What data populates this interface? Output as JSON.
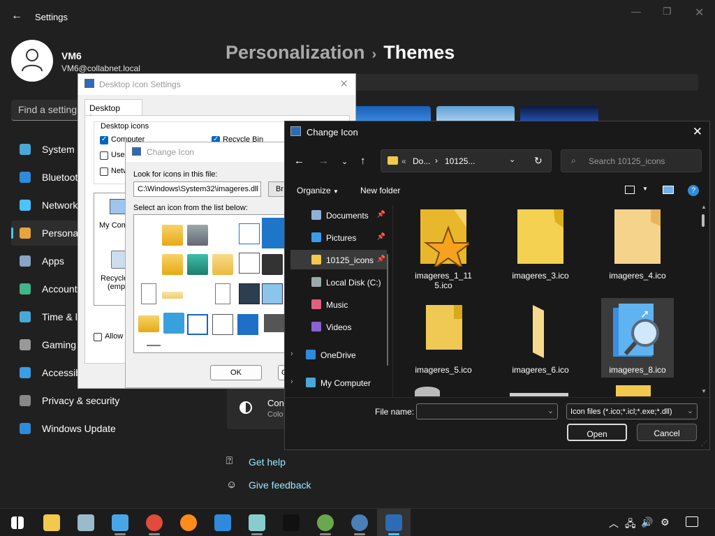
{
  "settings": {
    "title": "Settings",
    "user": {
      "name": "VM6",
      "email": "VM6@collabnet.local"
    },
    "search_placeholder": "Find a setting",
    "nav": [
      {
        "label": "System",
        "icon": "monitor-icon",
        "color": "#4aa8d8"
      },
      {
        "label": "Bluetooth & devices",
        "icon": "bluetooth-icon",
        "color": "#2e8bdb"
      },
      {
        "label": "Network & internet",
        "icon": "wifi-icon",
        "color": "#4cc2ff"
      },
      {
        "label": "Personalization",
        "icon": "brush-icon",
        "color": "#e8a33d"
      },
      {
        "label": "Apps",
        "icon": "apps-icon",
        "color": "#8aa4c8"
      },
      {
        "label": "Accounts",
        "icon": "person-icon",
        "color": "#3fb68b"
      },
      {
        "label": "Time & language",
        "icon": "clock-icon",
        "color": "#4aa8d8"
      },
      {
        "label": "Gaming",
        "icon": "gamepad-icon",
        "color": "#999"
      },
      {
        "label": "Accessibility",
        "icon": "accessibility-icon",
        "color": "#3b9de6"
      },
      {
        "label": "Privacy & security",
        "icon": "shield-icon",
        "color": "#888"
      },
      {
        "label": "Windows Update",
        "icon": "update-icon",
        "color": "#2e8bdb"
      }
    ],
    "breadcrumb": {
      "parent": "Personalization",
      "current": "Themes"
    },
    "contrast_label": "Con",
    "contrast_sub": "Colo",
    "get_help": "Get help",
    "give_feedback": "Give feedback"
  },
  "desktop_icon_settings": {
    "title": "Desktop Icon Settings",
    "tab": "Desktop Icons",
    "group_label": "Desktop icons",
    "checks": [
      {
        "label": "Computer",
        "checked": true
      },
      {
        "label": "Recycle Bin",
        "checked": true
      },
      {
        "label": "User",
        "checked": false
      },
      {
        "label": "Netw",
        "checked": false
      }
    ],
    "preview_labels": [
      "My Comp",
      "Recycle",
      "(empt"
    ],
    "allow_label": "Allow t"
  },
  "change_icon_classic": {
    "title": "Change Icon",
    "look_for_label": "Look for icons in this file:",
    "path_value": "C:\\Windows\\System32\\imageres.dll",
    "browse_label": "Br",
    "select_label": "Select an icon from the list below:",
    "ok_label": "OK",
    "cancel_partial": "C"
  },
  "file_dialog": {
    "title": "Change Icon",
    "address": {
      "prefix": "«",
      "part1": "Do...",
      "part2": "10125..."
    },
    "search_placeholder": "Search 10125_icons",
    "organize": "Organize",
    "new_folder": "New folder",
    "tree": [
      {
        "label": "Documents",
        "icon": "documents-icon",
        "color": "#8fb0d9",
        "pinned": true
      },
      {
        "label": "Pictures",
        "icon": "pictures-icon",
        "color": "#3b9de6",
        "pinned": true
      },
      {
        "label": "10125_icons",
        "icon": "folder-icon",
        "color": "#f2c94c",
        "pinned": true
      },
      {
        "label": "Local Disk (C:)",
        "icon": "drive-icon",
        "color": "#9aa"
      },
      {
        "label": "Music",
        "icon": "music-icon",
        "color": "#e0607e"
      },
      {
        "label": "Videos",
        "icon": "videos-icon",
        "color": "#8a63d2"
      },
      {
        "label": "OneDrive",
        "icon": "onedrive-icon",
        "color": "#2e8bdb"
      },
      {
        "label": "My Computer",
        "icon": "computer-icon",
        "color": "#4aa8d8"
      }
    ],
    "files": [
      {
        "name": "imageres_1_115.ico",
        "kind": "folder-star"
      },
      {
        "name": "imageres_3.ico",
        "kind": "folder"
      },
      {
        "name": "imageres_4.ico",
        "kind": "folder-open"
      },
      {
        "name": "imageres_5.ico",
        "kind": "folder-side"
      },
      {
        "name": "imageres_6.ico",
        "kind": "folder-thin"
      },
      {
        "name": "imageres_8.ico",
        "kind": "folder-search"
      }
    ],
    "file_name_label": "File name:",
    "file_name_value": "",
    "file_type": "Icon files (*.ico;*.icl;*.exe;*.dll)",
    "open_label": "Open",
    "cancel_label": "Cancel"
  },
  "taskbar": {
    "apps": [
      "start-icon",
      "file-explorer-icon",
      "resource-monitor-icon",
      "remote-desktop-icon",
      "chrome-icon",
      "firefox-icon",
      "notepad-icon",
      "notepad-plus-icon",
      "7zip-icon",
      "photo-icon",
      "settings-gear-icon",
      "desktop-icon-settings-icon"
    ],
    "tray": [
      "chevron-up-icon",
      "network-icon",
      "volume-icon",
      "gear-icon",
      "notification-icon"
    ]
  }
}
